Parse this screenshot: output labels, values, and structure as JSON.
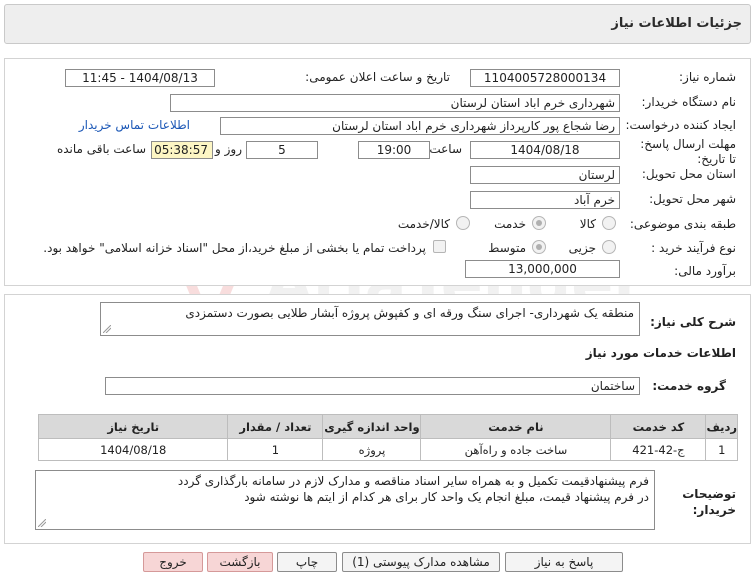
{
  "header": {
    "title": "جزئیات اطلاعات نیاز"
  },
  "form": {
    "need_number_label": "شماره نیاز:",
    "need_number": "1104005728000134",
    "announce_label": "تاریخ و ساعت اعلان عمومی:",
    "announce_value": "1404/08/13 - 11:45",
    "buyer_org_label": "نام دستگاه خریدار:",
    "buyer_org": "شهرداری خرم اباد استان لرستان",
    "requester_label": "ایجاد کننده درخواست:",
    "requester": "رضا شجاع پور کارپرداز شهرداری خرم اباد استان لرستان",
    "contact_link": "اطلاعات تماس خریدار",
    "deadline_label": "مهلت ارسال پاسخ: تا تاریخ:",
    "deadline_date": "1404/08/18",
    "time_label": "ساعت",
    "deadline_time": "19:00",
    "days_value": "5",
    "days_label": "روز و",
    "remaining_time": "05:38:57",
    "remaining_label": "ساعت باقی مانده",
    "province_label": "استان محل تحویل:",
    "province": "لرستان",
    "city_label": "شهر محل تحویل:",
    "city": "خرم آباد",
    "category_label": "طبقه بندی موضوعی:",
    "category_options": [
      "کالا",
      "خدمت",
      "کالا/خدمت"
    ],
    "category_selected": "خدمت",
    "process_label": "نوع فرآیند خرید :",
    "process_options": [
      "جزیی",
      "متوسط"
    ],
    "process_selected": "متوسط",
    "payment_note": "پرداخت تمام یا بخشی از مبلغ خرید،از محل \"اسناد خزانه اسلامی\" خواهد بود.",
    "estimate_label": "برآورد مالی:",
    "estimate": "13,000,000"
  },
  "summary": {
    "label": "شرح کلی نیاز:",
    "text": "منطقه یک شهرداری- اجرای سنگ ورقه ای و کفپوش پروژه آبشار طلایی بصورت دستمزدی",
    "services_title": "اطلاعات خدمات مورد نیاز",
    "service_group_label": "گروه خدمت:",
    "service_group": "ساختمان"
  },
  "table": {
    "headers": [
      "ردیف",
      "کد خدمت",
      "نام خدمت",
      "واحد اندازه گیری",
      "تعداد / مقدار",
      "تاریخ نیاز"
    ],
    "rows": [
      [
        "1",
        "ج-42-421",
        "ساخت جاده و راه‌آهن",
        "پروژه",
        "1",
        "1404/08/18"
      ]
    ]
  },
  "buyer_notes": {
    "label": "توضیحات خریدار:",
    "line1": "فرم پیشنهادقیمت تکمیل و به همراه سایر اسناد مناقصه و مدارک لازم در سامانه بارگذاری گردد",
    "line2": "در فرم پیشنهاد قیمت، مبلغ انجام یک واحد کار برای هر کدام از ایتم ها نوشته شود"
  },
  "buttons": {
    "respond": "پاسخ به نیاز",
    "attachments": "مشاهده مدارک پیوستی (1)",
    "print": "چاپ",
    "back": "بازگشت",
    "exit": "خروج"
  },
  "watermark": {
    "text": "AriaTender.neT"
  },
  "colors": {
    "header_bg": "#eeeeee",
    "table_header_bg": "#d9d9d9",
    "link": "#1b57b6",
    "remaining_bg": "#fdf6c4",
    "danger_button_bg": "#f7d6d6"
  }
}
